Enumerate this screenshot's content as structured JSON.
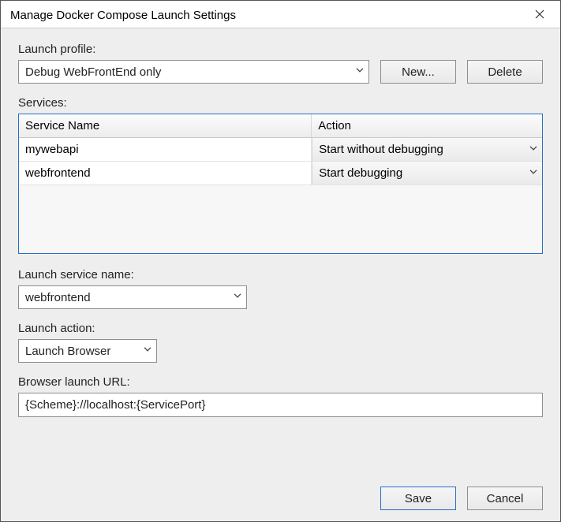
{
  "title": "Manage Docker Compose Launch Settings",
  "labels": {
    "launchProfile": "Launch profile:",
    "services": "Services:",
    "launchServiceName": "Launch service name:",
    "launchAction": "Launch action:",
    "browserLaunchUrl": "Browser launch URL:"
  },
  "profileDropdown": {
    "selected": "Debug WebFrontEnd only"
  },
  "buttons": {
    "new": "New...",
    "delete": "Delete",
    "save": "Save",
    "cancel": "Cancel"
  },
  "servicesGrid": {
    "headers": {
      "name": "Service Name",
      "action": "Action"
    },
    "rows": [
      {
        "name": "mywebapi",
        "action": "Start without debugging"
      },
      {
        "name": "webfrontend",
        "action": "Start debugging"
      }
    ]
  },
  "launchServiceName": {
    "selected": "webfrontend"
  },
  "launchAction": {
    "selected": "Launch Browser"
  },
  "browserLaunchUrl": "{Scheme}://localhost:{ServicePort}"
}
